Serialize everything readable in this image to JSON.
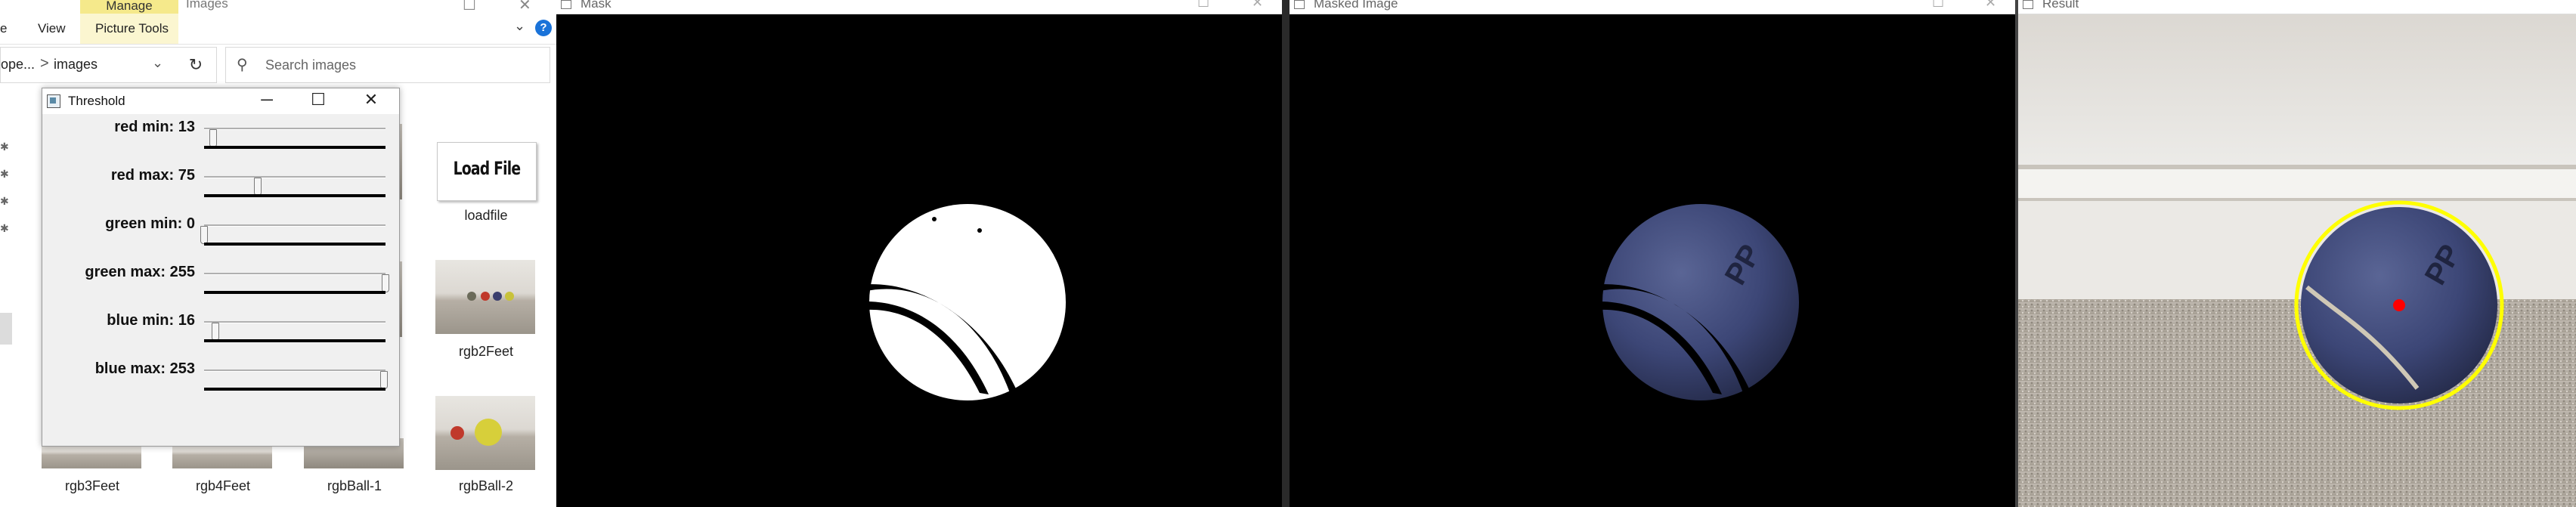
{
  "explorer": {
    "title_partial": "Images",
    "ribbon": {
      "manage_tab": "Manage",
      "tabs": [
        "e",
        "View",
        "Picture Tools"
      ]
    },
    "address": {
      "prefix": "ope...",
      "separator": ">",
      "folder": "images"
    },
    "search": {
      "placeholder": "Search images"
    },
    "files": [
      {
        "label": "loadfile"
      },
      {
        "label": "rgb2Feet"
      },
      {
        "label": "rgb3Feet"
      },
      {
        "label": "rgb4Feet"
      },
      {
        "label": "rgbBall-1"
      },
      {
        "label": "rgbBall-2"
      }
    ],
    "loadfile_thumb_text": "Load File",
    "icons": [
      "refresh-icon",
      "search-icon",
      "help-icon",
      "chevron-down-icon",
      "pin-icon"
    ]
  },
  "threshold": {
    "title": "Threshold",
    "sliders": [
      {
        "label": "red min: 13",
        "value": 13,
        "max": 255
      },
      {
        "label": "red max: 75",
        "value": 75,
        "max": 255
      },
      {
        "label": "green min: 0",
        "value": 0,
        "max": 255
      },
      {
        "label": "green max: 255",
        "value": 255,
        "max": 255
      },
      {
        "label": "blue min: 16",
        "value": 16,
        "max": 255
      },
      {
        "label": "blue max: 253",
        "value": 253,
        "max": 255
      }
    ]
  },
  "windows": {
    "mask": {
      "title": "Mask"
    },
    "masked": {
      "title": "Masked Image"
    },
    "result": {
      "title": "Result"
    }
  },
  "colors": {
    "manage_tab": "#f5e98b",
    "detection_circle": "#ffff00",
    "detection_center": "#ff0000"
  }
}
